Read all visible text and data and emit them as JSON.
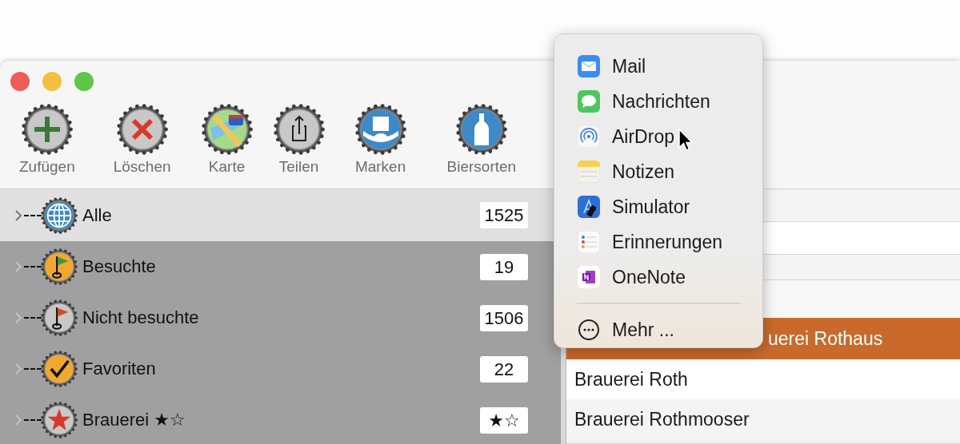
{
  "toolbar": [
    {
      "kind": "add",
      "label": "Zufügen"
    },
    {
      "kind": "delete",
      "label": "Löschen"
    },
    {
      "kind": "map",
      "label": "Karte"
    },
    {
      "kind": "share",
      "label": "Teilen"
    },
    {
      "kind": "brands",
      "label": "Marken"
    },
    {
      "kind": "beer-types",
      "label": "Biersorten"
    }
  ],
  "sidebar": {
    "items": [
      {
        "kind": "globe",
        "label": "Alle",
        "count": "1525",
        "selected": true
      },
      {
        "kind": "visited",
        "label": "Besuchte",
        "count": "19",
        "selected": false
      },
      {
        "kind": "unvisited",
        "label": "Nicht besuchte",
        "count": "1506",
        "selected": false
      },
      {
        "kind": "favorite",
        "label": "Favoriten",
        "count": "22",
        "selected": false
      },
      {
        "kind": "rating",
        "label": "Brauerei ★☆",
        "count": "★☆",
        "selected": false
      }
    ]
  },
  "list": {
    "rows": [
      {
        "name": "uerei Rothaus",
        "selected": true
      },
      {
        "name": "Brauerei Roth",
        "selected": false
      },
      {
        "name": "Brauerei Rothmooser",
        "selected": false
      }
    ]
  },
  "share_menu": {
    "items": [
      {
        "kind": "mail",
        "label": "Mail"
      },
      {
        "kind": "messages",
        "label": "Nachrichten"
      },
      {
        "kind": "airdrop",
        "label": "AirDrop"
      },
      {
        "kind": "notes",
        "label": "Notizen"
      },
      {
        "kind": "simulator",
        "label": "Simulator"
      },
      {
        "kind": "reminders",
        "label": "Erinnerungen"
      },
      {
        "kind": "onenote",
        "label": "OneNote"
      }
    ],
    "more": {
      "label": "Mehr ..."
    }
  }
}
